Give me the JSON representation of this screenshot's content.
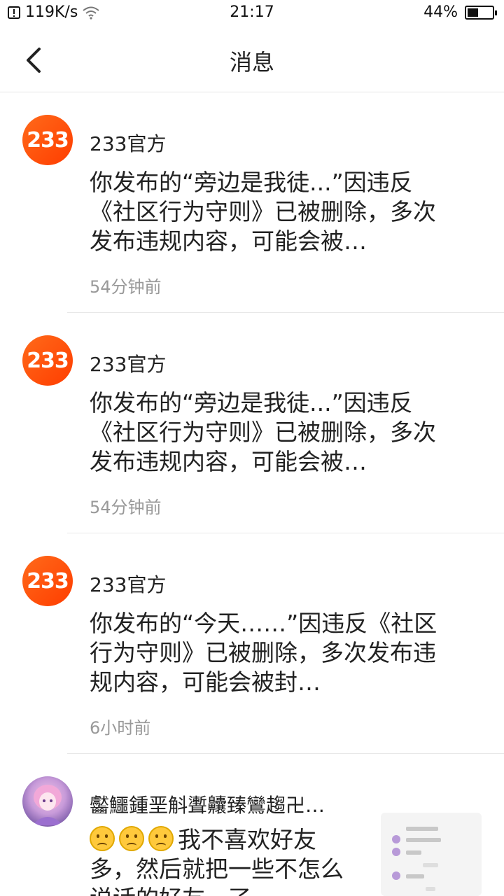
{
  "status_bar": {
    "network_speed": "119K/s",
    "time": "21:17",
    "battery_percent": "44%",
    "battery_level": 0.44
  },
  "nav": {
    "title": "消息"
  },
  "messages": [
    {
      "sender": "233官方",
      "avatar_text": "233",
      "content": "你发布的“旁边是我徒...”因违反《社区行为守则》已被删除，多次发布违规内容，可能会被…",
      "time": "54分钟前"
    },
    {
      "sender": "233官方",
      "avatar_text": "233",
      "content": "你发布的“旁边是我徒...”因违反《社区行为守则》已被删除，多次发布违规内容，可能会被…",
      "time": "54分钟前"
    },
    {
      "sender": "233官方",
      "avatar_text": "233",
      "content": "你发布的“今天……”因违反《社区行为守则》已被删除，多次发布违规内容，可能会被封…",
      "time": "6小时前"
    },
    {
      "sender": "齾鱷鍾垩斛聻齉臻鸞趨卍…",
      "content": "我不喜欢好友多，然后就把一些不怎么说话的好友，了"
    }
  ],
  "colors": {
    "brand_orange": "#ff5a14",
    "text_primary": "#222222",
    "text_secondary": "#999999",
    "divider": "#e8e8e8"
  }
}
